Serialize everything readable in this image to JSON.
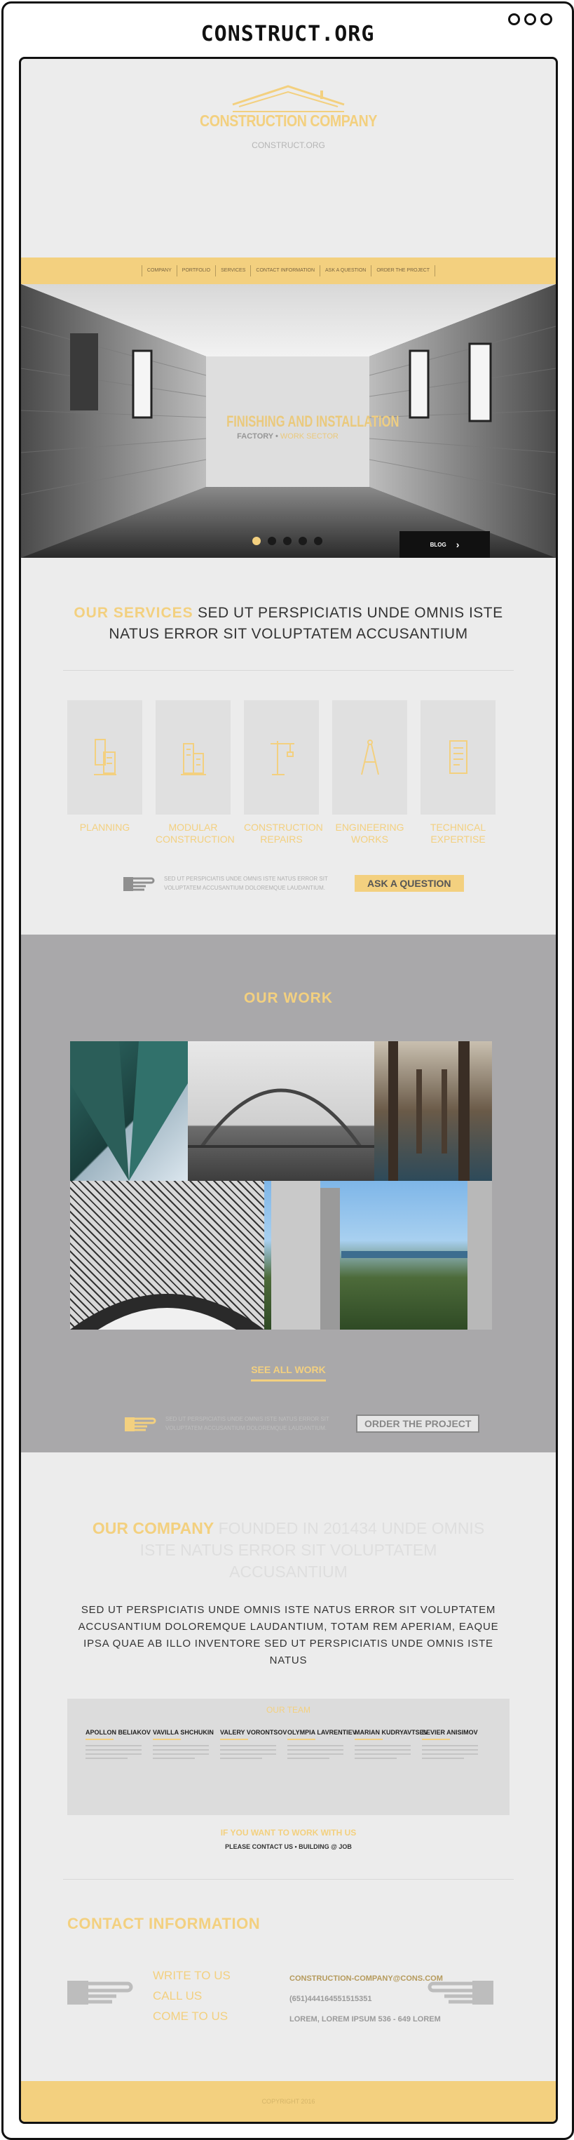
{
  "window": {
    "title": "CONSTRUCT.ORG"
  },
  "header": {
    "logo_name": "CONSTRUCTION COMPANY",
    "logo_sub": "CONSTRUCT.ORG"
  },
  "nav": {
    "items": [
      "COMPANY",
      "PORTFOLIO",
      "SERVICES",
      "CONTACT INFORMATION",
      "ASK A QUESTION",
      "ORDER THE PROJECT"
    ]
  },
  "hero": {
    "heading": "FINISHING AND INSTALLATION",
    "sub_prefix": "FACTORY •",
    "sub_highlight": "WORK SECTOR",
    "blog_label": "BLOG",
    "blog_arrow": "›",
    "slides": 5,
    "active_slide": 1
  },
  "services": {
    "title_highlight": "OUR SERVICES",
    "title_rest": "SED UT PERSPICIATIS UNDE OMNIS ISTE NATUS ERROR SIT VOLUPTATEM ACCUSANTIUM",
    "items": [
      {
        "label": "PLANNING",
        "icon": "planning-icon"
      },
      {
        "label": "MODULAR CONSTRUCTION",
        "icon": "modular-building-icon"
      },
      {
        "label": "CONSTRUCTION REPAIRS",
        "icon": "crane-icon"
      },
      {
        "label": "ENGINEERING WORKS",
        "icon": "compass-icon"
      },
      {
        "label": "TECHNICAL EXPERTISE",
        "icon": "document-icon"
      }
    ],
    "cta_text": "SED UT PERSPICIATIS UNDE OMNIS ISTE NATUS ERROR SIT VOLUPTATEM ACCUSANTIUM DOLOREMQUE LAUDANTIUM.",
    "cta_button": "ASK A QUESTION"
  },
  "work": {
    "title": "OUR WORK",
    "see_all": "SEE ALL WORK",
    "cta_text": "SED UT PERSPICIATIS UNDE OMNIS ISTE NATUS ERROR SIT VOLUPTATEM ACCUSANTIUM DOLOREMQUE LAUDANTIUM.",
    "cta_button": "ORDER THE PROJECT"
  },
  "company": {
    "title_highlight": "OUR COMPANY",
    "title_rest": "FOUNDED IN 201434 UNDE OMNIS ISTE NATUS ERROR SIT VOLUPTATEM ACCUSANTIUM",
    "text": "SED UT PERSPICIATIS UNDE OMNIS ISTE NATUS ERROR SIT VOLUPTATEM ACCUSANTIUM DOLOREMQUE LAUDANTIUM, TOTAM REM APERIAM, EAQUE IPSA QUAE AB ILLO INVENTORE SED UT PERSPICIATIS UNDE OMNIS ISTE NATUS",
    "team_title": "OUR TEAM",
    "team": [
      {
        "name": "APOLLON BELIAKOV"
      },
      {
        "name": "VAVILLA SHCHUKIN"
      },
      {
        "name": "VALERY VORONTSOV"
      },
      {
        "name": "OLYMPIA LAVRENTIEV"
      },
      {
        "name": "MARIAN KUDRYAVTSEV"
      },
      {
        "name": "SEVIER ANISIMOV"
      }
    ],
    "work_with": "IF YOU WANT TO WORK WITH US",
    "contact_line": "PLEASE CONTACT US  •  BUILDING @ JOB"
  },
  "contact": {
    "title": "CONTACT INFORMATION",
    "links": [
      "WRITE TO US",
      "CALL US",
      "COME TO US"
    ],
    "email": "CONSTRUCTION-COMPANY@CONS.COM",
    "phone": "(651)444164551515351",
    "address": "LOREM, LOREM IPSUM 536 - 649 LOREM"
  },
  "footer": {
    "text": "COPYRIGHT 2016"
  },
  "colors": {
    "accent": "#f3d07f",
    "work_bg": "#a9a8aa",
    "page_bg": "#ececec"
  }
}
